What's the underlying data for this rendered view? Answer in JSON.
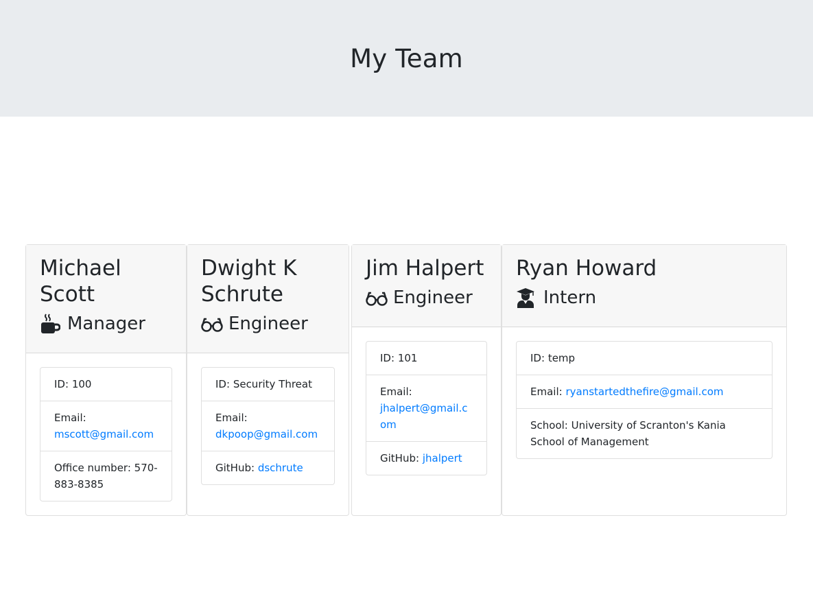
{
  "header": {
    "title": "My Team"
  },
  "team": [
    {
      "name": "Michael Scott",
      "role": "Manager",
      "role_icon": "coffee-mug-icon",
      "id_label": "ID:",
      "id": "100",
      "email_label": "Email:",
      "email": "mscott@gmail.com",
      "extra_label": "Office number:",
      "extra": "570-883-8385"
    },
    {
      "name": "Dwight K Schrute",
      "role": "Engineer",
      "role_icon": "glasses-icon",
      "id_label": "ID:",
      "id": "Security Threat",
      "email_label": "Email:",
      "email": "dkpoop@gmail.com",
      "extra_label": "GitHub:",
      "extra": "dschrute"
    },
    {
      "name": "Jim Halpert",
      "role": "Engineer",
      "role_icon": "glasses-icon",
      "id_label": "ID:",
      "id": "101",
      "email_label": "Email:",
      "email": "jhalpert@gmail.com",
      "extra_label": "GitHub:",
      "extra": "jhalpert"
    },
    {
      "name": "Ryan Howard",
      "role": "Intern",
      "role_icon": "graduate-icon",
      "id_label": "ID:",
      "id": "temp",
      "email_label": "Email:",
      "email": "ryanstartedthefire@gmail.com",
      "extra_label": "School:",
      "extra": "University of Scranton's Kania School of Management"
    }
  ],
  "colors": {
    "jumbotron_bg": "#e9ecef",
    "link": "#007bff",
    "header_bg": "#f7f7f7"
  }
}
